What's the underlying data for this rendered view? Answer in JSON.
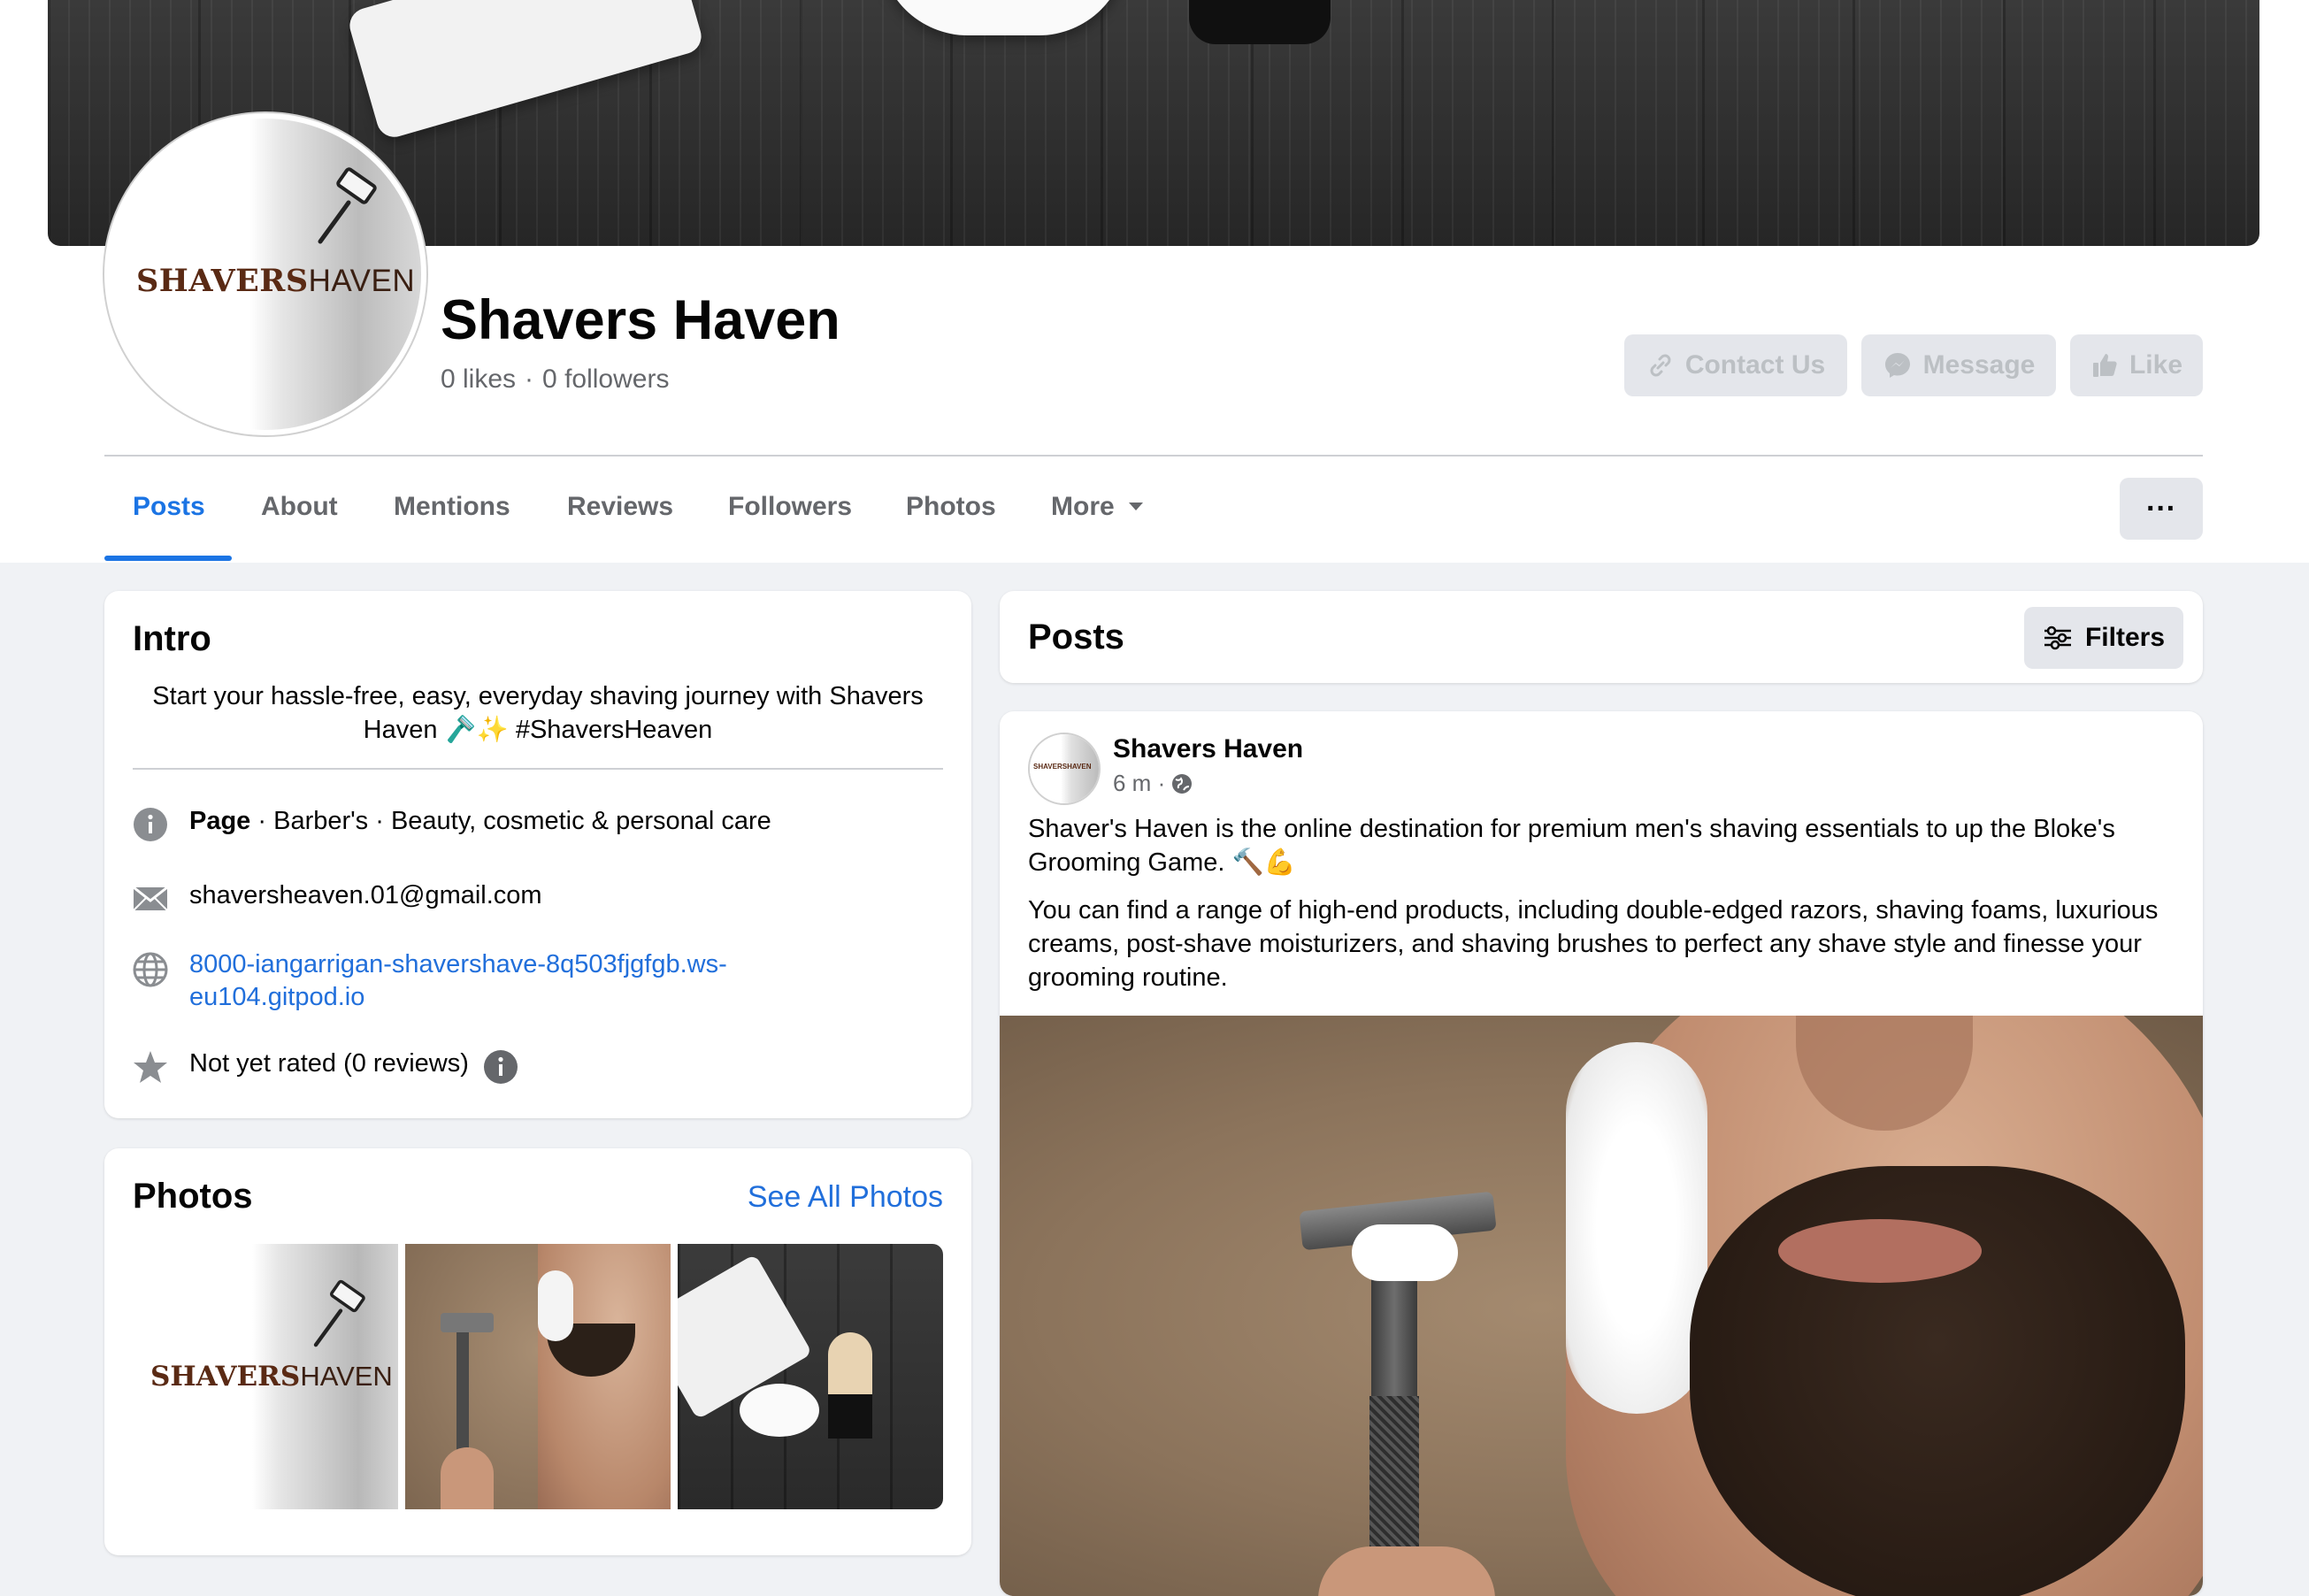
{
  "page": {
    "name": "Shavers Haven",
    "likes": "0 likes",
    "followers": "0 followers",
    "logo_bold": "SHAVERS",
    "logo_light": "HAVEN"
  },
  "actions": {
    "contact": "Contact Us",
    "message": "Message",
    "like": "Like"
  },
  "tabs": [
    "Posts",
    "About",
    "Mentions",
    "Reviews",
    "Followers",
    "Photos",
    "More"
  ],
  "more_menu": "···",
  "intro": {
    "title": "Intro",
    "bio": "Start your hassle-free, easy, everyday shaving journey with Shavers Haven 🪒✨ #ShaversHeaven",
    "category_label": "Page",
    "category": " · Barber's · Beauty, cosmetic & personal care",
    "email": "shaversheaven.01@gmail.com",
    "website_line1": "8000-iangarrigan-shavershave-8q503fjgfgb.ws-",
    "website_line2": "eu104.gitpod.io",
    "rating": "Not yet rated (0 reviews)"
  },
  "photos": {
    "title": "Photos",
    "see_all": "See All Photos"
  },
  "posts": {
    "title": "Posts",
    "filters": "Filters"
  },
  "post": {
    "author": "Shavers Haven",
    "time": "6 m ·",
    "para1": "Shaver's Haven is the online destination for premium men's shaving essentials to up the Bloke's Grooming Game. 🔨💪",
    "para2": "You can find a range of high-end products, including double-edged razors, shaving foams, luxurious creams, post-shave moisturizers, and shaving brushes to perfect any shave style and finesse your grooming routine."
  },
  "colors": {
    "accent": "#1b74e4",
    "link": "#216fdb",
    "muted": "#65676b",
    "bg": "#f0f2f5"
  }
}
